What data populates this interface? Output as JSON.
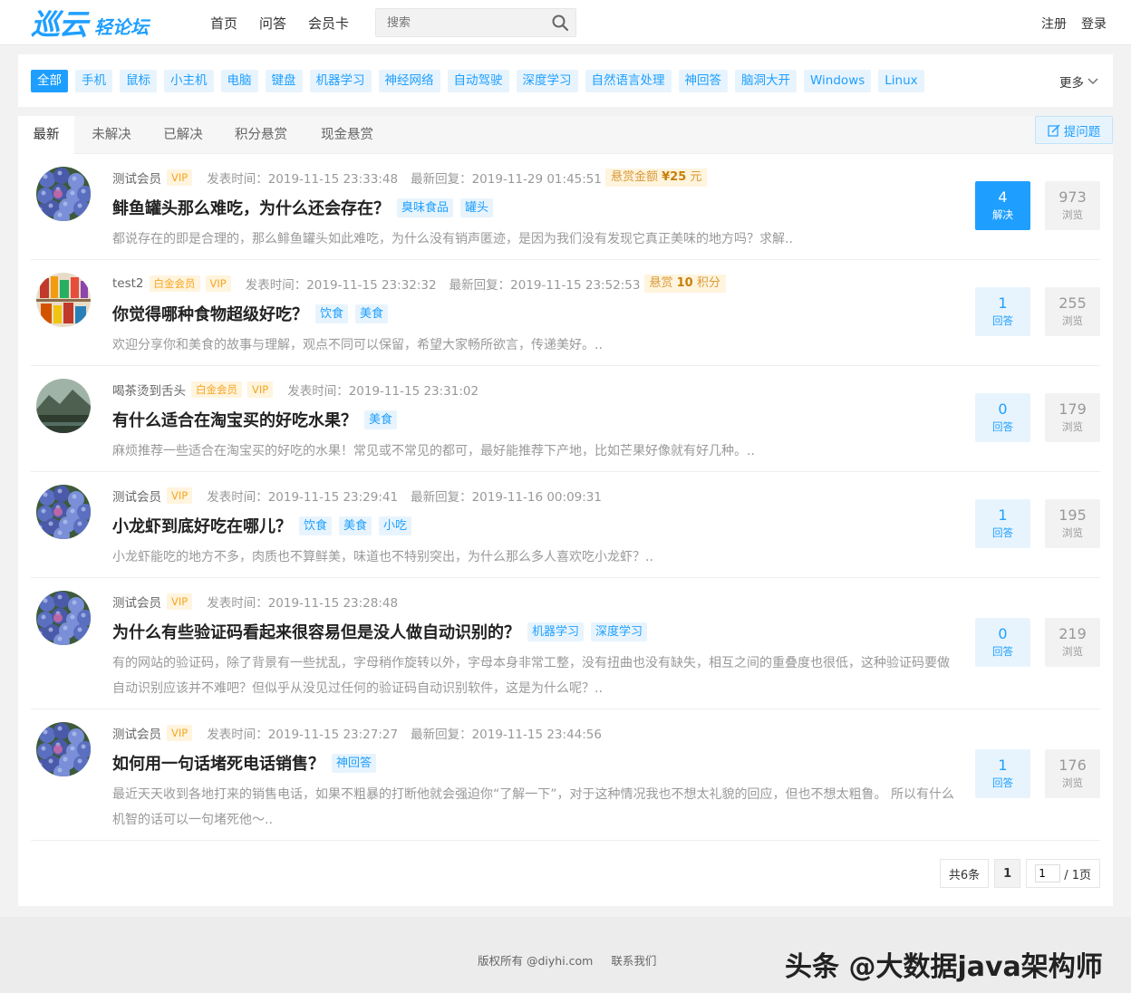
{
  "header": {
    "logo_main": "巡云",
    "logo_sub": "轻论坛",
    "nav": [
      "首页",
      "问答",
      "会员卡"
    ],
    "search_placeholder": "搜索",
    "register": "注册",
    "login": "登录"
  },
  "categories": {
    "items": [
      "全部",
      "手机",
      "鼠标",
      "小主机",
      "电脑",
      "键盘",
      "机器学习",
      "神经网络",
      "自动驾驶",
      "深度学习",
      "自然语言处理",
      "神回答",
      "脑洞大开",
      "Windows",
      "Linux"
    ],
    "active_index": 0,
    "more_label": "更多"
  },
  "tabs": {
    "items": [
      "最新",
      "未解决",
      "已解决",
      "积分悬赏",
      "现金悬赏"
    ],
    "active_index": 0,
    "ask_label": "提问题"
  },
  "questions": [
    {
      "author": "测试会员",
      "badges": [
        "VIP"
      ],
      "post_time": "发表时间：2019-11-15 23:33:48",
      "last_reply": "最新回复：2019-11-29 01:45:51",
      "reward_prefix": "悬赏金额 ",
      "reward_amount": "¥25",
      "reward_suffix": " 元",
      "title": "鲱鱼罐头那么难吃，为什么还会存在？",
      "tags": [
        "臭味食品",
        "罐头"
      ],
      "excerpt": "都说存在的即是合理的，那么鲱鱼罐头如此难吃，为什么没有销声匿迹，是因为我们没有发现它真正美味的地方吗？求解..",
      "answers": "4",
      "answers_label": "解决",
      "solved": true,
      "views": "973",
      "views_label": "浏览"
    },
    {
      "author": "test2",
      "badges": [
        "白金会员",
        "VIP"
      ],
      "post_time": "发表时间：2019-11-15 23:32:32",
      "last_reply": "最新回复：2019-11-15 23:52:53",
      "reward_prefix": "悬赏 ",
      "reward_amount": "10",
      "reward_suffix": " 积分",
      "title": "你觉得哪种食物超级好吃？",
      "tags": [
        "饮食",
        "美食"
      ],
      "excerpt": "欢迎分享你和美食的故事与理解，观点不同可以保留，希望大家畅所欲言，传递美好。..",
      "answers": "1",
      "answers_label": "回答",
      "solved": false,
      "views": "255",
      "views_label": "浏览"
    },
    {
      "author": "喝茶烫到舌头",
      "badges": [
        "白金会员",
        "VIP"
      ],
      "post_time": "发表时间：2019-11-15 23:31:02",
      "last_reply": "",
      "reward_prefix": "",
      "reward_amount": "",
      "reward_suffix": "",
      "title": "有什么适合在淘宝买的好吃水果？",
      "tags": [
        "美食"
      ],
      "excerpt": "麻烦推荐一些适合在淘宝买的好吃的水果！常见或不常见的都可，最好能推荐下产地，比如芒果好像就有好几种。..",
      "answers": "0",
      "answers_label": "回答",
      "solved": false,
      "views": "179",
      "views_label": "浏览"
    },
    {
      "author": "测试会员",
      "badges": [
        "VIP"
      ],
      "post_time": "发表时间：2019-11-15 23:29:41",
      "last_reply": "最新回复：2019-11-16 00:09:31",
      "reward_prefix": "",
      "reward_amount": "",
      "reward_suffix": "",
      "title": "小龙虾到底好吃在哪儿？",
      "tags": [
        "饮食",
        "美食",
        "小吃"
      ],
      "excerpt": "小龙虾能吃的地方不多，肉质也不算鲜美，味道也不特别突出，为什么那么多人喜欢吃小龙虾？..",
      "answers": "1",
      "answers_label": "回答",
      "solved": false,
      "views": "195",
      "views_label": "浏览"
    },
    {
      "author": "测试会员",
      "badges": [
        "VIP"
      ],
      "post_time": "发表时间：2019-11-15 23:28:48",
      "last_reply": "",
      "reward_prefix": "",
      "reward_amount": "",
      "reward_suffix": "",
      "title": "为什么有些验证码看起来很容易但是没人做自动识别的？",
      "tags": [
        "机器学习",
        "深度学习"
      ],
      "excerpt": "有的网站的验证码，除了背景有一些扰乱，字母稍作旋转以外，字母本身非常工整，没有扭曲也没有缺失，相互之间的重叠度也很低，这种验证码要做自动识别应该并不难吧？但似乎从没见过任何的验证码自动识别软件，这是为什么呢？..",
      "answers": "0",
      "answers_label": "回答",
      "solved": false,
      "views": "219",
      "views_label": "浏览"
    },
    {
      "author": "测试会员",
      "badges": [
        "VIP"
      ],
      "post_time": "发表时间：2019-11-15 23:27:27",
      "last_reply": "最新回复：2019-11-15 23:44:56",
      "reward_prefix": "",
      "reward_amount": "",
      "reward_suffix": "",
      "title": "如何用一句话堵死电话销售？",
      "tags": [
        "神回答"
      ],
      "excerpt": "最近天天收到各地打来的销售电话，如果不粗暴的打断他就会强迫你“了解一下”，对于这种情况我也不想太礼貌的回应，但也不想太粗鲁。 所以有什么机智的话可以一句堵死他～..",
      "answers": "1",
      "answers_label": "回答",
      "solved": false,
      "views": "176",
      "views_label": "浏览"
    }
  ],
  "pager": {
    "total": "共6条",
    "current": "1",
    "input_value": "1",
    "pages": "/ 1页"
  },
  "footer": {
    "copyright": "版权所有 @diyhi.com",
    "contact": "联系我们",
    "watermark": "头条 @大数据java架构师"
  },
  "colors": {
    "accent": "#1e9fff",
    "accent_light": "#e8f4fd",
    "vip_bg": "#fff4dd",
    "vip_text": "#f5a623"
  },
  "icons": [
    "search-icon",
    "edit-icon",
    "chevron-down-icon"
  ]
}
